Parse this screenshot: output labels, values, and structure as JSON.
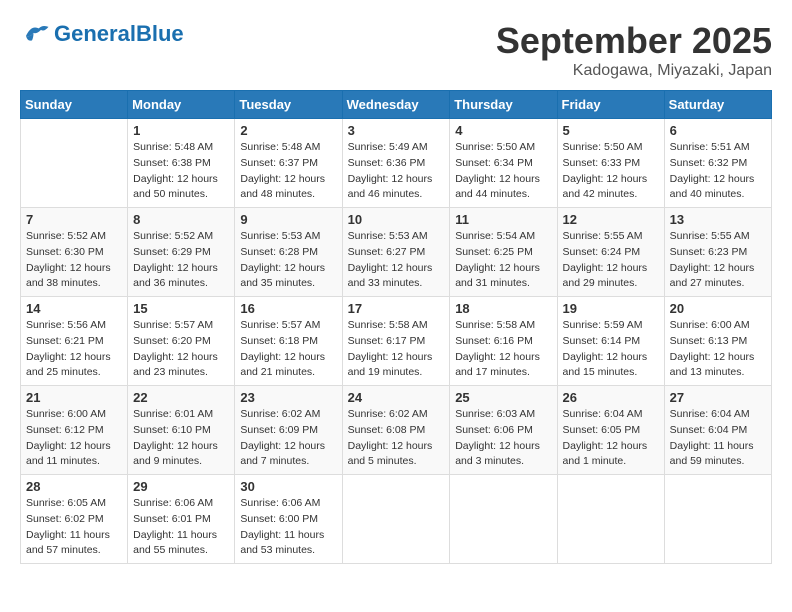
{
  "header": {
    "logo_general": "General",
    "logo_blue": "Blue",
    "month": "September 2025",
    "location": "Kadogawa, Miyazaki, Japan"
  },
  "days_of_week": [
    "Sunday",
    "Monday",
    "Tuesday",
    "Wednesday",
    "Thursday",
    "Friday",
    "Saturday"
  ],
  "weeks": [
    [
      {
        "day": "",
        "info": ""
      },
      {
        "day": "1",
        "info": "Sunrise: 5:48 AM\nSunset: 6:38 PM\nDaylight: 12 hours\nand 50 minutes."
      },
      {
        "day": "2",
        "info": "Sunrise: 5:48 AM\nSunset: 6:37 PM\nDaylight: 12 hours\nand 48 minutes."
      },
      {
        "day": "3",
        "info": "Sunrise: 5:49 AM\nSunset: 6:36 PM\nDaylight: 12 hours\nand 46 minutes."
      },
      {
        "day": "4",
        "info": "Sunrise: 5:50 AM\nSunset: 6:34 PM\nDaylight: 12 hours\nand 44 minutes."
      },
      {
        "day": "5",
        "info": "Sunrise: 5:50 AM\nSunset: 6:33 PM\nDaylight: 12 hours\nand 42 minutes."
      },
      {
        "day": "6",
        "info": "Sunrise: 5:51 AM\nSunset: 6:32 PM\nDaylight: 12 hours\nand 40 minutes."
      }
    ],
    [
      {
        "day": "7",
        "info": "Sunrise: 5:52 AM\nSunset: 6:30 PM\nDaylight: 12 hours\nand 38 minutes."
      },
      {
        "day": "8",
        "info": "Sunrise: 5:52 AM\nSunset: 6:29 PM\nDaylight: 12 hours\nand 36 minutes."
      },
      {
        "day": "9",
        "info": "Sunrise: 5:53 AM\nSunset: 6:28 PM\nDaylight: 12 hours\nand 35 minutes."
      },
      {
        "day": "10",
        "info": "Sunrise: 5:53 AM\nSunset: 6:27 PM\nDaylight: 12 hours\nand 33 minutes."
      },
      {
        "day": "11",
        "info": "Sunrise: 5:54 AM\nSunset: 6:25 PM\nDaylight: 12 hours\nand 31 minutes."
      },
      {
        "day": "12",
        "info": "Sunrise: 5:55 AM\nSunset: 6:24 PM\nDaylight: 12 hours\nand 29 minutes."
      },
      {
        "day": "13",
        "info": "Sunrise: 5:55 AM\nSunset: 6:23 PM\nDaylight: 12 hours\nand 27 minutes."
      }
    ],
    [
      {
        "day": "14",
        "info": "Sunrise: 5:56 AM\nSunset: 6:21 PM\nDaylight: 12 hours\nand 25 minutes."
      },
      {
        "day": "15",
        "info": "Sunrise: 5:57 AM\nSunset: 6:20 PM\nDaylight: 12 hours\nand 23 minutes."
      },
      {
        "day": "16",
        "info": "Sunrise: 5:57 AM\nSunset: 6:18 PM\nDaylight: 12 hours\nand 21 minutes."
      },
      {
        "day": "17",
        "info": "Sunrise: 5:58 AM\nSunset: 6:17 PM\nDaylight: 12 hours\nand 19 minutes."
      },
      {
        "day": "18",
        "info": "Sunrise: 5:58 AM\nSunset: 6:16 PM\nDaylight: 12 hours\nand 17 minutes."
      },
      {
        "day": "19",
        "info": "Sunrise: 5:59 AM\nSunset: 6:14 PM\nDaylight: 12 hours\nand 15 minutes."
      },
      {
        "day": "20",
        "info": "Sunrise: 6:00 AM\nSunset: 6:13 PM\nDaylight: 12 hours\nand 13 minutes."
      }
    ],
    [
      {
        "day": "21",
        "info": "Sunrise: 6:00 AM\nSunset: 6:12 PM\nDaylight: 12 hours\nand 11 minutes."
      },
      {
        "day": "22",
        "info": "Sunrise: 6:01 AM\nSunset: 6:10 PM\nDaylight: 12 hours\nand 9 minutes."
      },
      {
        "day": "23",
        "info": "Sunrise: 6:02 AM\nSunset: 6:09 PM\nDaylight: 12 hours\nand 7 minutes."
      },
      {
        "day": "24",
        "info": "Sunrise: 6:02 AM\nSunset: 6:08 PM\nDaylight: 12 hours\nand 5 minutes."
      },
      {
        "day": "25",
        "info": "Sunrise: 6:03 AM\nSunset: 6:06 PM\nDaylight: 12 hours\nand 3 minutes."
      },
      {
        "day": "26",
        "info": "Sunrise: 6:04 AM\nSunset: 6:05 PM\nDaylight: 12 hours\nand 1 minute."
      },
      {
        "day": "27",
        "info": "Sunrise: 6:04 AM\nSunset: 6:04 PM\nDaylight: 11 hours\nand 59 minutes."
      }
    ],
    [
      {
        "day": "28",
        "info": "Sunrise: 6:05 AM\nSunset: 6:02 PM\nDaylight: 11 hours\nand 57 minutes."
      },
      {
        "day": "29",
        "info": "Sunrise: 6:06 AM\nSunset: 6:01 PM\nDaylight: 11 hours\nand 55 minutes."
      },
      {
        "day": "30",
        "info": "Sunrise: 6:06 AM\nSunset: 6:00 PM\nDaylight: 11 hours\nand 53 minutes."
      },
      {
        "day": "",
        "info": ""
      },
      {
        "day": "",
        "info": ""
      },
      {
        "day": "",
        "info": ""
      },
      {
        "day": "",
        "info": ""
      }
    ]
  ]
}
